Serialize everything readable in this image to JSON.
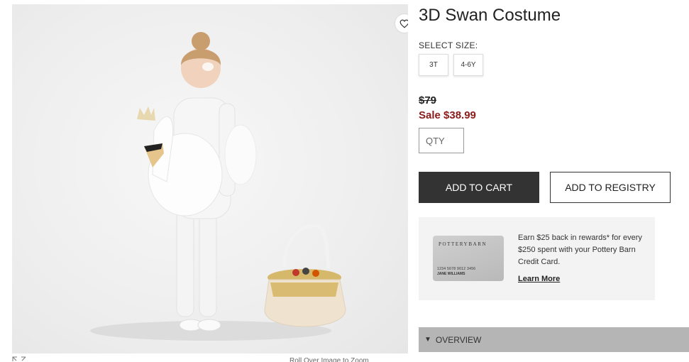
{
  "product": {
    "title": "3D Swan Costume",
    "image_alt": "Child wearing a white 3D swan costume next to a gold tutu treat basket"
  },
  "size_selector": {
    "label": "SELECT SIZE:",
    "options": [
      "3T",
      "4-6Y"
    ]
  },
  "pricing": {
    "original": "$79",
    "sale": "Sale $38.99"
  },
  "quantity": {
    "placeholder": "QTY"
  },
  "actions": {
    "add_to_cart": "ADD TO CART",
    "add_to_registry": "ADD TO REGISTRY"
  },
  "promo": {
    "card_brand": "POTTERYBARN",
    "card_number": "1234 5678 9012 3456",
    "card_name": "JANE WILLIAMS",
    "text": "Earn $25 back in rewards* for every $250 spent with your Pottery Barn Credit Card.",
    "link": "Learn More"
  },
  "overview": {
    "label": "OVERVIEW"
  },
  "image_footer": {
    "caption": "Roll Over Image to Zoom"
  },
  "colors": {
    "sale_red": "#8b1a1a",
    "cart_button": "#333333",
    "overview_bar": "#b5b5b5",
    "promo_bg": "#f3f3f3"
  },
  "icons": {
    "favorite": "heart-outline-icon",
    "expand": "expand-arrows-icon",
    "overview_toggle": "triangle-down-icon",
    "caption": "zoom-icon"
  }
}
